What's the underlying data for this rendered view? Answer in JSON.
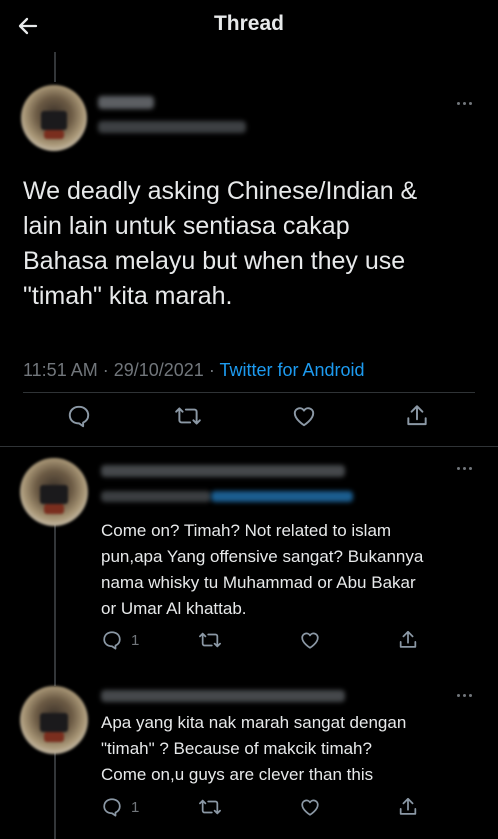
{
  "header": {
    "title": "Thread"
  },
  "main_tweet": {
    "text": "We deadly asking Chinese/Indian &\nlain lain untuk sentiasa cakap\nBahasa melayu but when they use\n\"timah\" kita marah.",
    "time": "11:51 AM",
    "separator": " · ",
    "date": "29/10/2021",
    "source": "Twitter for Android"
  },
  "replies": [
    {
      "text": "Come on? Timah? Not related to islam\npun,apa Yang offensive sangat? Bukannya\nnama whisky tu Muhammad or Abu Bakar\nor Umar Al khattab.",
      "reply_count": "1"
    },
    {
      "text": "Apa yang kita nak marah sangat dengan\n\"timah\" ? Because of makcik timah?\nCome on,u guys are clever than this",
      "reply_count": "1"
    }
  ],
  "icons": {
    "back": "back-arrow-icon",
    "more": "more-dots-icon",
    "reply": "reply-icon",
    "retweet": "retweet-icon",
    "like": "heart-icon",
    "share": "share-icon"
  },
  "colors": {
    "background": "#000000",
    "text": "#e7e9ea",
    "muted": "#71767b",
    "link": "#1d9bf0",
    "divider": "#2f3336"
  }
}
